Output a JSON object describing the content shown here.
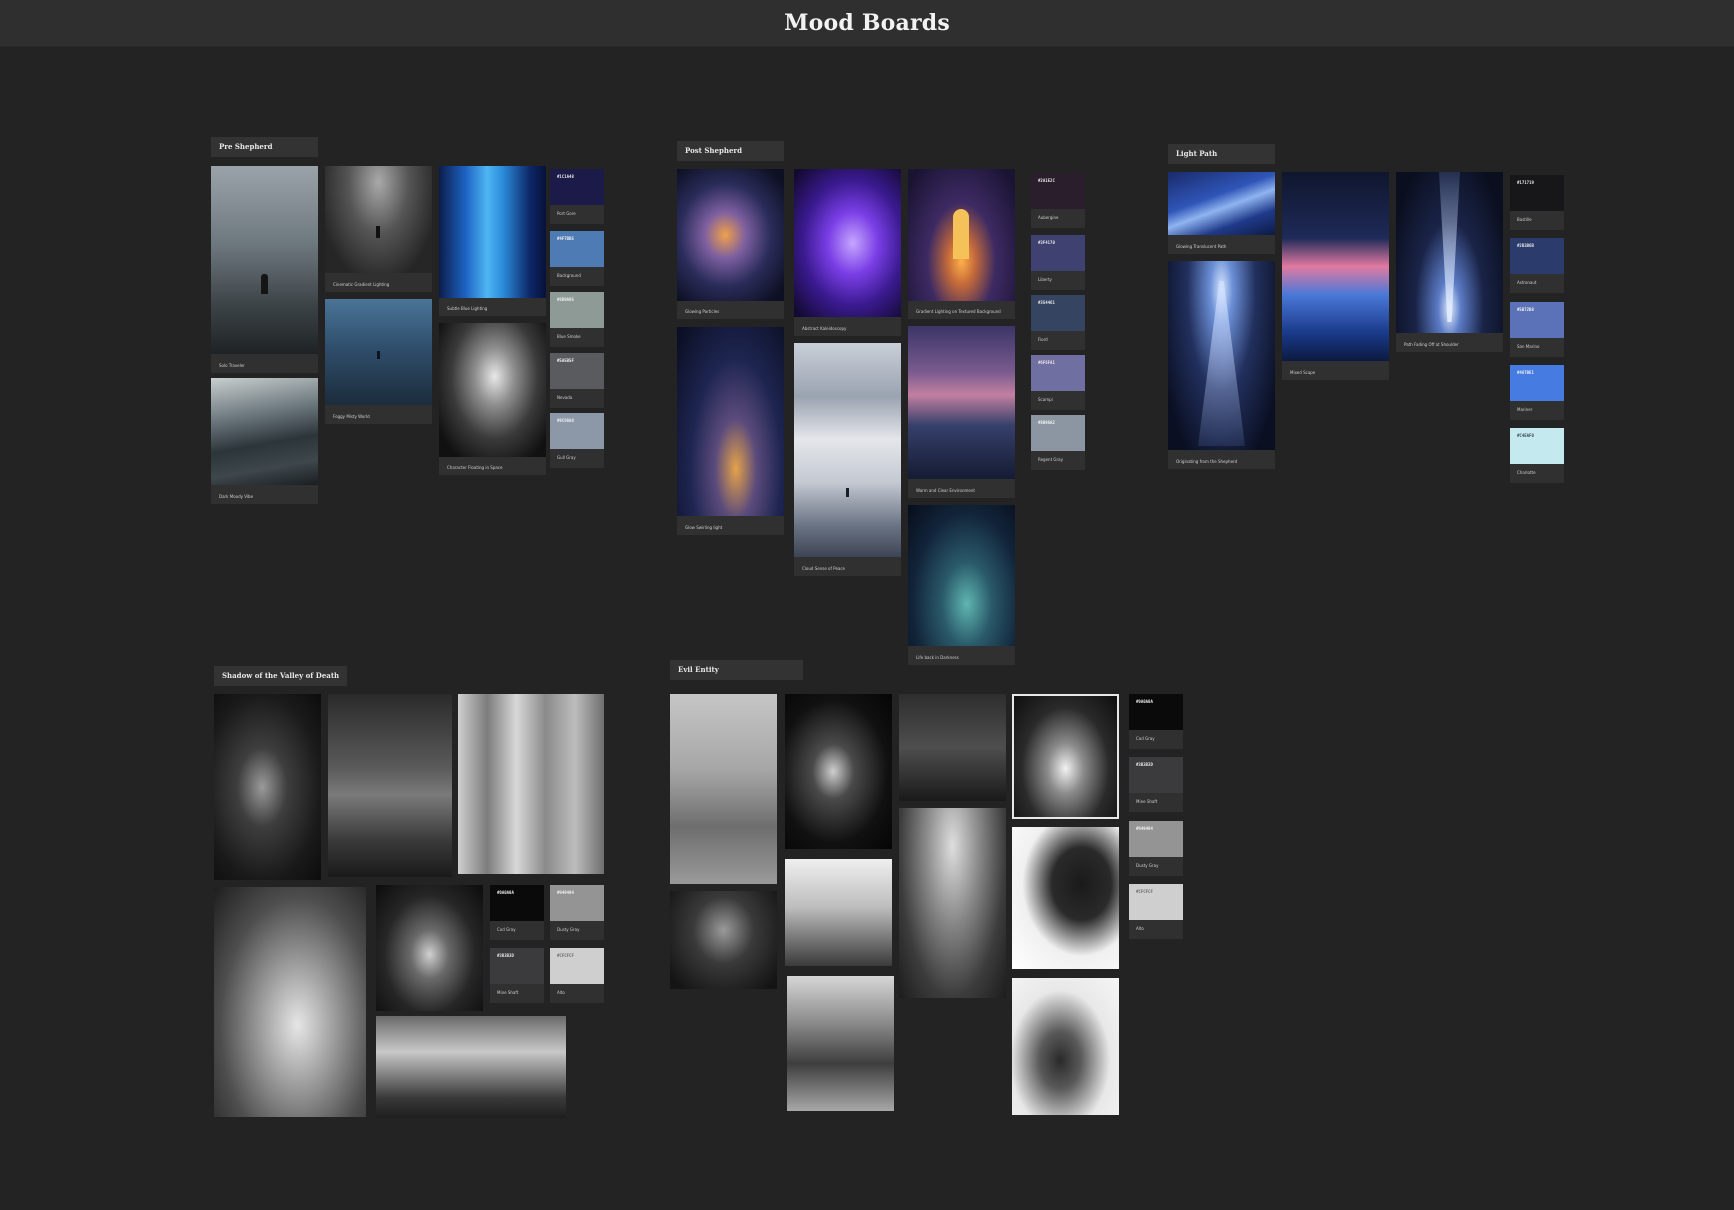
{
  "header": {
    "title": "Mood Boards"
  },
  "boards": {
    "pre_shepherd": {
      "title": "Pre Shepherd",
      "captions": [
        "Solo Traveler",
        "Cinematic Gradient Lighting",
        "Subtle Blue Lighting",
        "Foggy Misty World",
        "Dark Moody Vibe",
        "Character Floating in Space"
      ],
      "swatches": [
        {
          "hex": "#1C1A48",
          "name": "Port Gore",
          "color": "#1c1a48"
        },
        {
          "hex": "#4F7BB5",
          "name": "Background",
          "color": "#4f7bb5"
        },
        {
          "hex": "#8D9A95",
          "name": "Blue Smoke",
          "color": "#8d9a95"
        },
        {
          "hex": "#5A5B5F",
          "name": "Nevada",
          "color": "#5a5b5f"
        },
        {
          "hex": "#8C98A8",
          "name": "Gull Gray",
          "color": "#8c98a8"
        }
      ]
    },
    "post_shepherd": {
      "title": "Post Shepherd",
      "captions": [
        "Glowing Particles",
        "Abstract Kaleidoscopy",
        "Gradient Lighting on Textured Background",
        "Glow Swirling light",
        "Cloud Sense of Peace",
        "Warm and Clear Environment",
        "Life back in Darkness"
      ],
      "swatches": [
        {
          "hex": "#2A1E2C",
          "name": "Aubergine",
          "color": "#2a1e2c"
        },
        {
          "hex": "#3F4170",
          "name": "Liberty",
          "color": "#3f4170"
        },
        {
          "hex": "#354461",
          "name": "Fiord",
          "color": "#354461"
        },
        {
          "hex": "#6F6FA1",
          "name": "Scampi",
          "color": "#6f6fa1"
        },
        {
          "hex": "#8B96A2",
          "name": "Regent Gray",
          "color": "#8b96a2"
        }
      ]
    },
    "light_path": {
      "title": "Light Path",
      "captions": [
        "Glowing Translucent Path",
        "Mixed Scape",
        "Path Fading Off at Shoulder",
        "Originating from the Shepherd"
      ],
      "swatches": [
        {
          "hex": "#171719",
          "name": "Bastille",
          "color": "#171719"
        },
        {
          "hex": "#2B3B6B",
          "name": "Astronaut",
          "color": "#2b3b6b"
        },
        {
          "hex": "#5B72B8",
          "name": "San Marino",
          "color": "#5b72b8"
        },
        {
          "hex": "#467BE1",
          "name": "Mariner",
          "color": "#467be1"
        },
        {
          "hex": "#C4EAF0",
          "name": "Charlotte",
          "color": "#c4eaf0"
        }
      ]
    },
    "valley": {
      "title": "Shadow of the Valley of Death",
      "swatches": [
        {
          "hex": "#0A0A0A",
          "name": "Cod Gray",
          "color": "#0a0a0a"
        },
        {
          "hex": "#949494",
          "name": "Dusty Gray",
          "color": "#949494"
        },
        {
          "hex": "#3B3B3D",
          "name": "Mine Shaft",
          "color": "#3b3b3d"
        },
        {
          "hex": "#CFCFCF",
          "name": "Alto",
          "color": "#cfcfcf"
        }
      ]
    },
    "evil_entity": {
      "title": "Evil Entity",
      "swatches": [
        {
          "hex": "#0A0A0A",
          "name": "Cod Gray",
          "color": "#0a0a0a"
        },
        {
          "hex": "#3B3B3D",
          "name": "Mine Shaft",
          "color": "#3b3b3d"
        },
        {
          "hex": "#949494",
          "name": "Dusty Gray",
          "color": "#949494"
        },
        {
          "hex": "#CFCFCF",
          "name": "Alto",
          "color": "#cfcfcf"
        }
      ]
    }
  }
}
